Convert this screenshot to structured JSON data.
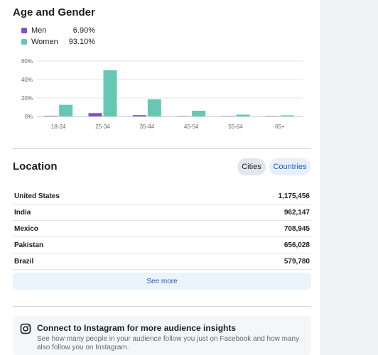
{
  "age_gender": {
    "title": "Age and Gender",
    "legend": [
      {
        "label": "Men",
        "value": "6.90%",
        "color": "#7b4fd6"
      },
      {
        "label": "Women",
        "value": "93.10%",
        "color": "#67c7b5"
      }
    ]
  },
  "chart_data": {
    "type": "bar",
    "categories": [
      "18-24",
      "25-34",
      "35-44",
      "45-54",
      "55-64",
      "65+"
    ],
    "series": [
      {
        "name": "Men",
        "values": [
          0.6,
          3.6,
          1.4,
          0.4,
          0.2,
          0.1
        ],
        "color": "#7b4fd6"
      },
      {
        "name": "Women",
        "values": [
          12.6,
          50,
          18.6,
          6.2,
          2.0,
          1.2
        ],
        "color": "#67c7b5"
      }
    ],
    "yticks": [
      "0%",
      "20%",
      "40%",
      "60%"
    ],
    "ylim": [
      0,
      60
    ],
    "grid": true
  },
  "location": {
    "title": "Location",
    "tabs": [
      "Cities",
      "Countries"
    ],
    "rows": [
      {
        "name": "United States",
        "value": "1,175,456"
      },
      {
        "name": "India",
        "value": "962,147"
      },
      {
        "name": "Mexico",
        "value": "708,945"
      },
      {
        "name": "Pakistan",
        "value": "656,028"
      },
      {
        "name": "Brazil",
        "value": "579,780"
      }
    ],
    "see_more": "See more"
  },
  "instagram": {
    "icon": "instagram-icon",
    "title": "Connect to Instagram for more audience insights",
    "description": "See how many people in your audience follow you just on Facebook and how many also follow you on Instagram."
  }
}
